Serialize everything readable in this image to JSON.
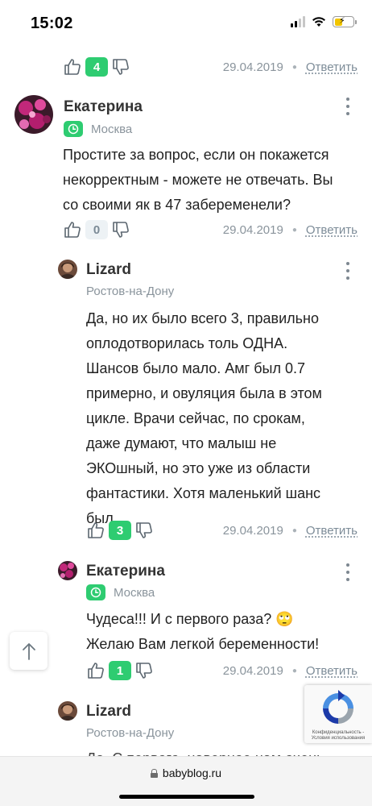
{
  "status": {
    "time": "15:02"
  },
  "comments": [
    {
      "vote_count": "4",
      "date": "29.04.2019",
      "reply": "Ответить"
    },
    {
      "author": "Екатерина",
      "city": "Москва",
      "text": [
        "Простите за вопрос, если он покажется",
        "некорректным - можете не отвечать. Вы",
        "со своими як в 47 забеременели?"
      ],
      "vote_count": "0",
      "date": "29.04.2019",
      "reply": "Ответить"
    },
    {
      "author": "Lizard",
      "city": "Ростов-на-Дону",
      "text": [
        "Да, но их было всего 3, правильно",
        "оплодотворилась толь ОДНА.",
        "Шансов было мало. Амг был 0.7",
        "примерно, и овуляция была в этом",
        "цикле. Врачи сейчас, по срокам,",
        "даже думают, что малыш не",
        "ЭКОшный, но это уже из области",
        "фантастики. Хотя маленький шанс",
        "был."
      ],
      "vote_count": "3",
      "date": "29.04.2019",
      "reply": "Ответить"
    },
    {
      "author": "Екатерина",
      "city": "Москва",
      "text": [
        "Чудеса!!! И с первого раза? 🙄",
        "Желаю Вам легкой беременности!"
      ],
      "vote_count": "1",
      "date": "29.04.2019",
      "reply": "Ответить"
    },
    {
      "author": "Lizard",
      "city": "Ростов-на-Дону",
      "text_partial": "Да. С первого, наверное нам очень"
    }
  ],
  "recaptcha": {
    "text": "Конфиденциальность - Условия использования"
  },
  "browser": {
    "url": "babyblog.ru"
  },
  "colors": {
    "accent_green": "#2ecc71",
    "muted": "#8a949c"
  }
}
